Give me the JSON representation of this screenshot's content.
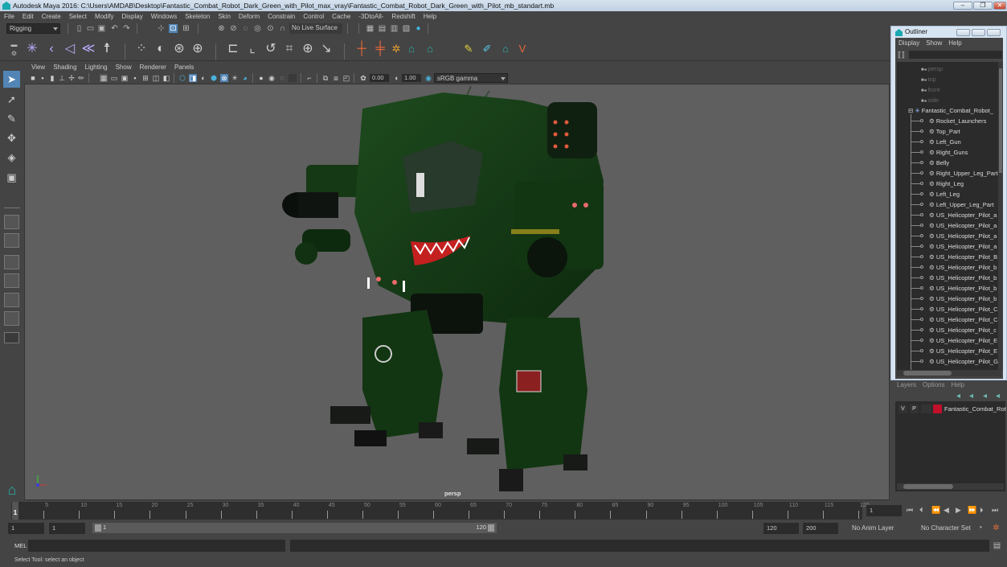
{
  "window": {
    "title": "Autodesk Maya 2016: C:\\Users\\AMDAB\\Desktop\\Fantastic_Combat_Robot_Dark_Green_with_Pilot_max_vray\\Fantastic_Combat_Robot_Dark_Green_with_Pilot_mb_standart.mb",
    "minimize": "–",
    "restore": "❐",
    "close": "✕"
  },
  "menubar": [
    "File",
    "Edit",
    "Create",
    "Select",
    "Modify",
    "Display",
    "Windows",
    "Skeleton",
    "Skin",
    "Deform",
    "Constrain",
    "Control",
    "Cache",
    "-3DtoAll-",
    "Redshift",
    "Help"
  ],
  "statusline": {
    "menuset": "Rigging",
    "live_surface": "No Live Surface"
  },
  "panel": {
    "menu": [
      "View",
      "Shading",
      "Lighting",
      "Show",
      "Renderer",
      "Panels"
    ],
    "exposure": "0.00",
    "gamma": "1.00",
    "colorspace": "sRGB gamma",
    "camera_label": "persp"
  },
  "outliner": {
    "title": "Outliner",
    "menu": [
      "Display",
      "Show",
      "Help"
    ],
    "cameras": [
      "persp",
      "top",
      "front",
      "side"
    ],
    "root": "Fantastic_Combat_Robot_",
    "children": [
      "Rocket_Launchers",
      "Top_Part",
      "Left_Gun",
      "Right_Guns",
      "Belly",
      "Right_Upper_Leg_Part",
      "Right_Leg",
      "Left_Leg",
      "Left_Upper_Leg_Part",
      "US_Helicopter_Pilot_a",
      "US_Helicopter_Pilot_a",
      "US_Helicopter_Pilot_a",
      "US_Helicopter_Pilot_a",
      "US_Helicopter_Pilot_B",
      "US_Helicopter_Pilot_b",
      "US_Helicopter_Pilot_b",
      "US_Helicopter_Pilot_b",
      "US_Helicopter_Pilot_b",
      "US_Helicopter_Pilot_C",
      "US_Helicopter_Pilot_C",
      "US_Helicopter_Pilot_c",
      "US_Helicopter_Pilot_E",
      "US_Helicopter_Pilot_E",
      "US_Helicopter_Pilot_G"
    ]
  },
  "layers": {
    "menu": [
      "Layers",
      "Options",
      "Help"
    ],
    "rows": [
      {
        "v": "V",
        "p": "P",
        "color": "#c0102a",
        "name": "Fantastic_Combat_Rot"
      }
    ]
  },
  "timeline": {
    "ticks": [
      5,
      10,
      15,
      20,
      25,
      30,
      35,
      40,
      45,
      50,
      55,
      60,
      65,
      70,
      75,
      80,
      85,
      90,
      95,
      100,
      105,
      110,
      115,
      120
    ],
    "current_frame": "1",
    "current_frame_field": "1",
    "start": "1",
    "playback_start": "1",
    "range_start_label": "1",
    "range_end_label": "120",
    "playback_end": "120",
    "end": "200",
    "anim_layer": "No Anim Layer",
    "character_set": "No Character Set"
  },
  "cmdline": {
    "label": "MEL"
  },
  "helpline": {
    "text": "Select Tool: select an object"
  }
}
